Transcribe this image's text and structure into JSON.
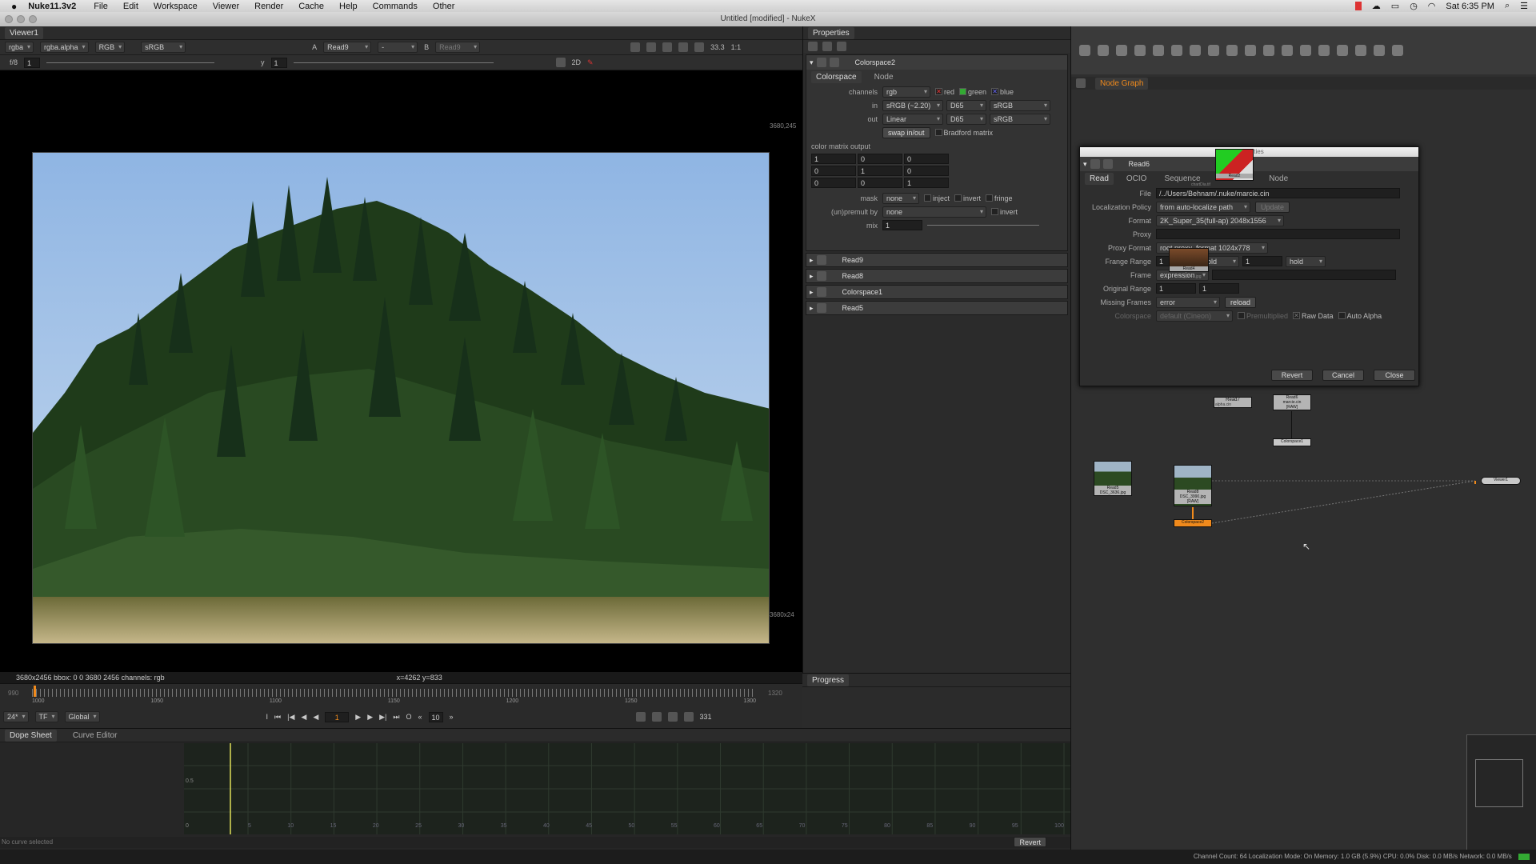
{
  "menubar": {
    "app": "Nuke11.3v2",
    "items": [
      "File",
      "Edit",
      "Workspace",
      "Viewer",
      "Render",
      "Cache",
      "Help",
      "Commands",
      "Other"
    ],
    "clock": "Sat 6:35 PM"
  },
  "window": {
    "title": "Untitled [modified] - NukeX"
  },
  "viewer": {
    "tab": "Viewer1",
    "channels": "rgba",
    "alpha": "rgba.alpha",
    "mode": "RGB",
    "lut": "sRGB",
    "input_a_label": "A",
    "input_a": "Read9",
    "input_sep": "-",
    "input_b_label": "B",
    "input_b": "Read9",
    "zoom": "33.3",
    "ratio": "1:1",
    "view": "2D",
    "fstop": "f/8",
    "gain": "1",
    "gamma_label": "y",
    "gamma": "1",
    "res_top": "3680,245",
    "res_bottom": "3680x24",
    "info": "3680x2456  bbox: 0 0 3680 2456 channels: rgb",
    "coords": "x=4262 y=833"
  },
  "timeline": {
    "start": "990",
    "end": "1320",
    "ticks": [
      "1000",
      "1050",
      "1100",
      "1150",
      "1200",
      "1250",
      "1300"
    ],
    "fps": "24*",
    "tf": "TF",
    "scope": "Global",
    "frame": "1",
    "step": "10",
    "total": "331"
  },
  "properties": {
    "title": "Properties",
    "colorspace2": {
      "name": "Colorspace2",
      "tabs": [
        "Colorspace",
        "Node"
      ],
      "channels_label": "channels",
      "channels": "rgb",
      "red": "red",
      "green": "green",
      "blue": "blue",
      "in_label": "in",
      "in_cs": "sRGB (~2.20)",
      "in_wp": "D65",
      "in_prim": "sRGB",
      "out_label": "out",
      "out_cs": "Linear",
      "out_wp": "D65",
      "out_prim": "sRGB",
      "swap": "swap in/out",
      "bradford": "Bradford matrix",
      "matrix_label": "color matrix output",
      "matrix": [
        "1",
        "0",
        "0",
        "0",
        "1",
        "0",
        "0",
        "0",
        "1"
      ],
      "mask_label": "mask",
      "mask": "none",
      "inject": "inject",
      "invert": "invert",
      "fringe": "fringe",
      "premult_label": "(un)premult by",
      "premult": "none",
      "invert2": "invert",
      "mix_label": "mix",
      "mix": "1"
    },
    "collapsed": [
      "Read9",
      "Read8",
      "Colorspace1",
      "Read5"
    ],
    "progress": "Progress"
  },
  "dopesheet": {
    "tabs": [
      "Dope Sheet",
      "Curve Editor"
    ],
    "y_ticks": [
      "0.5",
      "0"
    ],
    "x_ticks": [
      "5",
      "10",
      "15",
      "20",
      "25",
      "30",
      "35",
      "40",
      "45",
      "50",
      "55",
      "60",
      "65",
      "70",
      "75",
      "80",
      "85",
      "90",
      "95",
      "100"
    ],
    "status": "No curve selected",
    "revert": "Revert"
  },
  "nodegraph": {
    "tab": "Node Graph",
    "float_title": "Properties",
    "read6": {
      "name": "Read6",
      "tabs": [
        "Read",
        "OCIO",
        "Sequence",
        "Metadata",
        "Node"
      ],
      "file_label": "File",
      "file": "/../Users/Behnam/.nuke/marcie.cin",
      "loc_label": "Localization Policy",
      "loc": "from auto-localize path",
      "update": "Update",
      "format_label": "Format",
      "format": "2K_Super_35(full-ap) 2048x1556",
      "proxy_label": "Proxy",
      "pformat_label": "Proxy Format",
      "pformat": "root.proxy_format 1024x778",
      "frange_label": "Frange Range",
      "frange_a": "1",
      "hold_a": "hold",
      "frange_b": "1",
      "hold_b": "hold",
      "frame_label": "Frame",
      "frame": "expression",
      "orange_label": "Original Range",
      "orange_a": "1",
      "orange_b": "1",
      "missing_label": "Missing Frames",
      "missing": "error",
      "reload": "reload",
      "cs_label": "Colorspace",
      "cs": "default (Cineon)",
      "premult": "Premultiplied",
      "raw": "Raw Data",
      "auto_alpha": "Auto Alpha",
      "revert": "Revert",
      "cancel": "Cancel",
      "close": "Close"
    },
    "nodes": {
      "read7": "Read7",
      "read7_sub": "alpha.cin",
      "read6": "Read6",
      "read6_sub": "marcie.cin",
      "read6_sub2": "[RAW]",
      "colorspace1": "Colorspace1",
      "read5": "Read5",
      "read5_sub": "DSC_3636.jpg",
      "read8": "Read8",
      "read8_sub": "DSC_3990.jpg",
      "read8_sub2": "[RAW]",
      "colorspace2": "Colorspace2",
      "viewer1": "Viewer1",
      "read2": "Read2",
      "read2_sub": "chartDia.tif",
      "read4": "Read4",
      "read4_sub": "DSC_3641.jpg"
    },
    "status": "Channel Count: 64  Localization Mode: On  Memory: 1.0 GB (5.9%)  CPU: 0.0%  Disk: 0.0 MB/s  Network: 0.0 MB/s"
  },
  "colors": {
    "accent": "#f08a1c",
    "panel": "#2b2b2b",
    "sky": "#a9c6e8"
  }
}
